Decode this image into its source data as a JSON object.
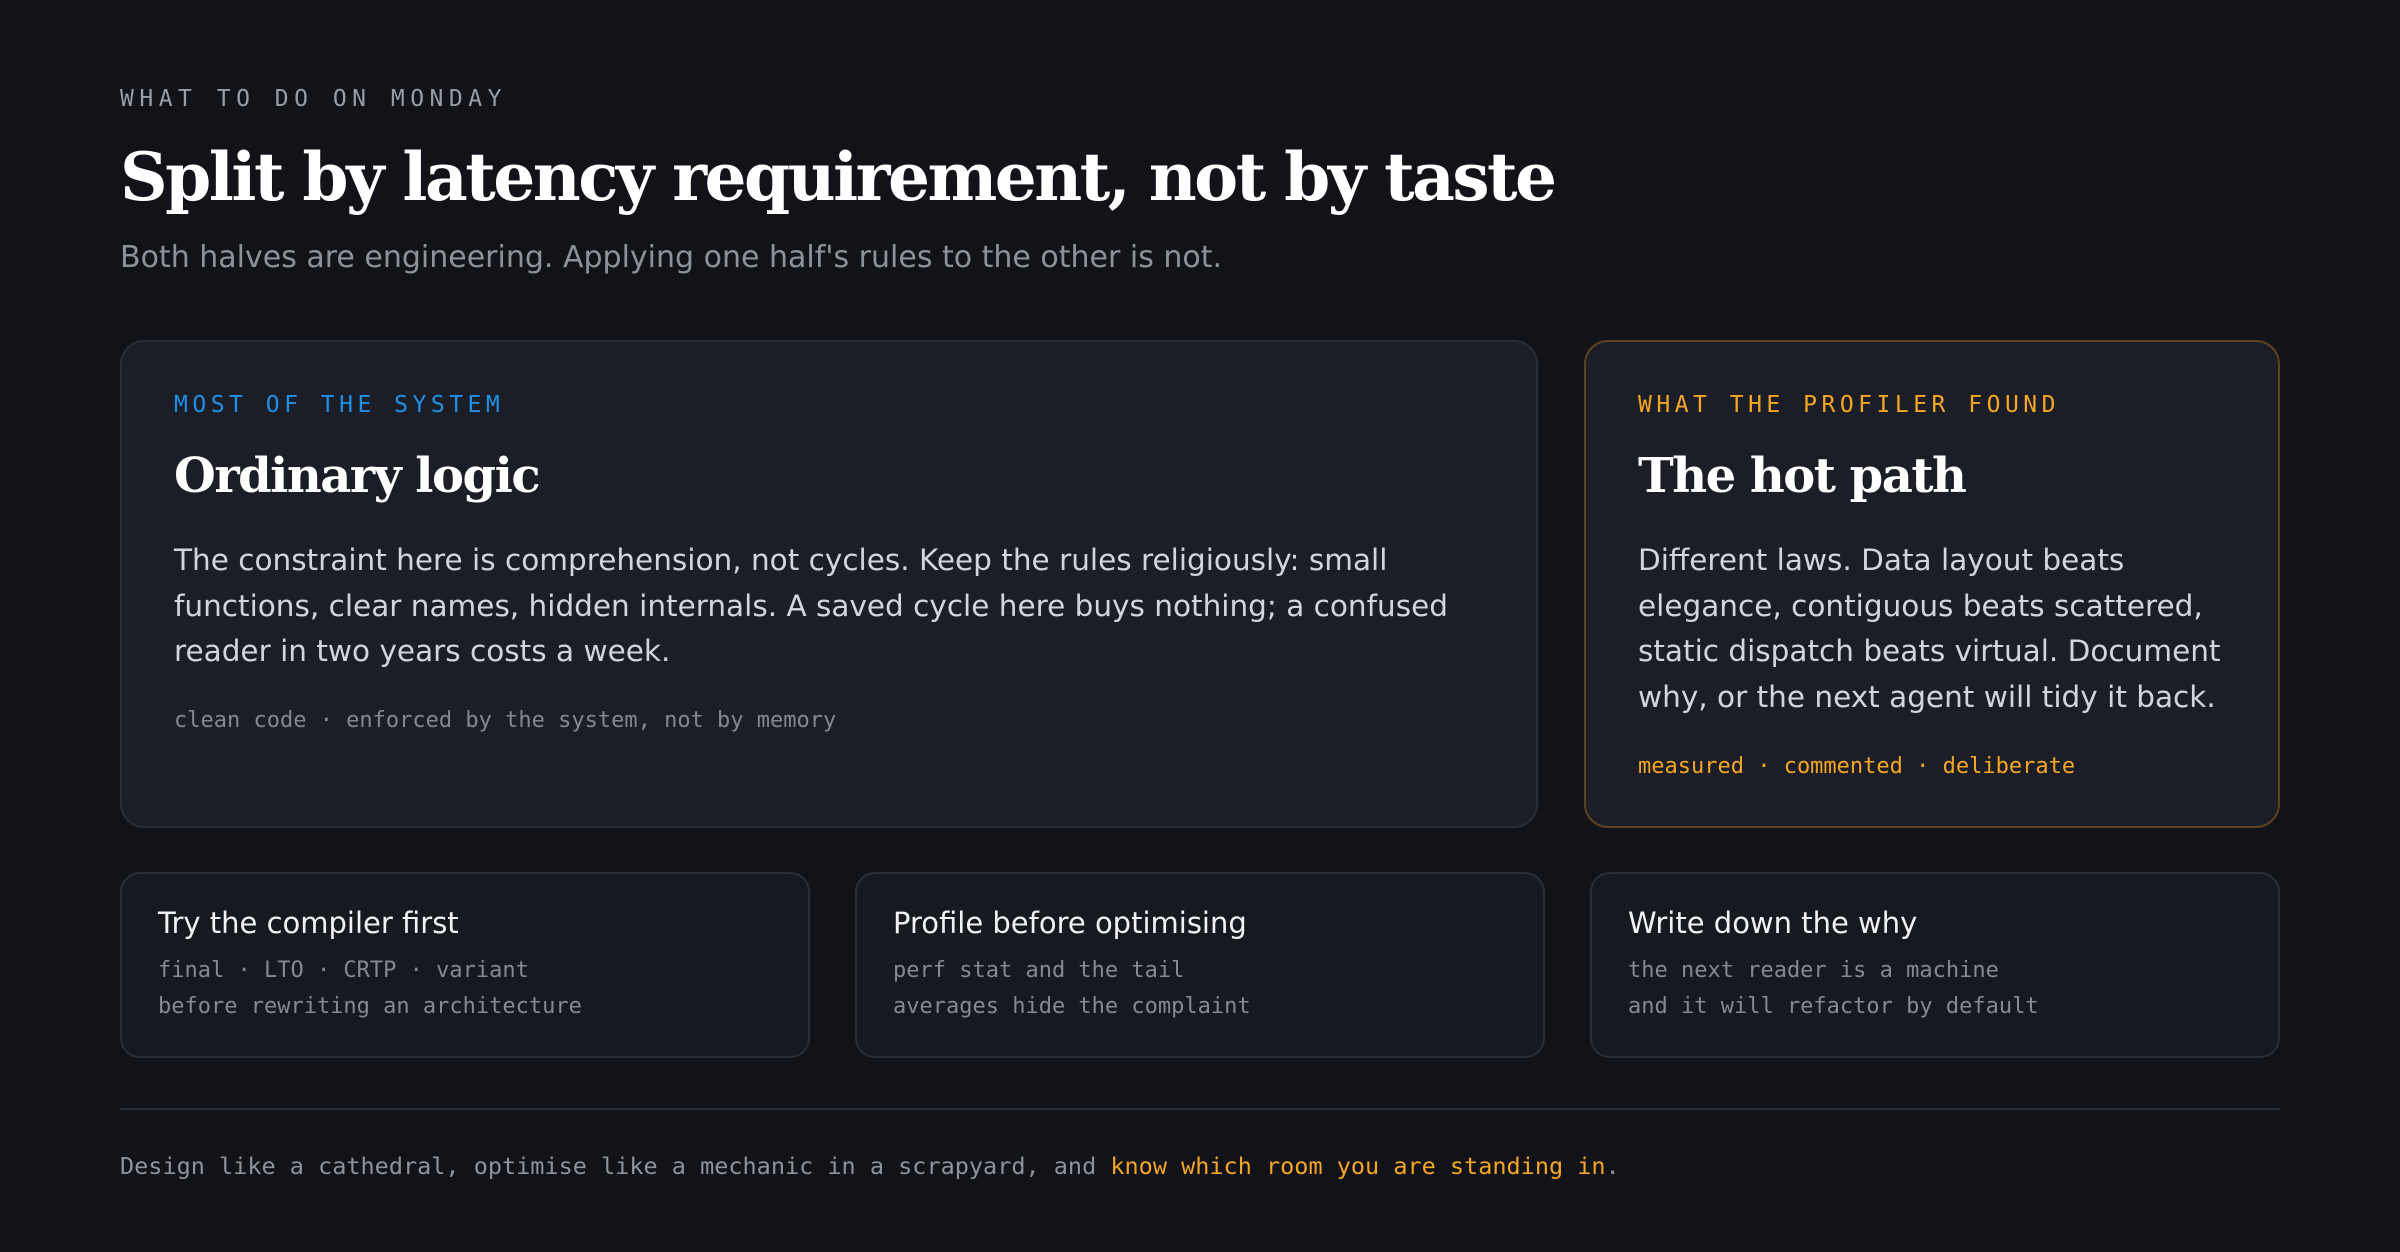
{
  "header": {
    "eyebrow": "WHAT TO DO ON MONDAY",
    "title": "Split by latency requirement, not by taste",
    "subtitle": "Both halves are engineering. Applying one half's rules to the other is not."
  },
  "cards": {
    "ordinary": {
      "label": "MOST OF THE SYSTEM",
      "label_color": "#1e90e6",
      "heading": "Ordinary logic",
      "body": "The constraint here is comprehension, not cycles. Keep the rules religiously: small functions, clear names, hidden internals. A saved cycle here buys nothing; a confused reader in two years costs a week.",
      "foot": "clean code · enforced by the system, not by memory"
    },
    "hot": {
      "label": "WHAT THE PROFILER FOUND",
      "label_color": "#f5a623",
      "heading": "The hot path",
      "body": "Different laws. Data layout beats elegance, contiguous beats scattered, static dispatch beats virtual. Document why, or the next agent will tidy it back.",
      "foot": "measured · commented · deliberate"
    }
  },
  "tips": [
    {
      "title": "Try the compiler first",
      "line1": "final · LTO · CRTP · variant",
      "line2": "before rewriting an architecture"
    },
    {
      "title": "Profile before optimising",
      "line1": "perf stat and the tail",
      "line2": "averages hide the complaint"
    },
    {
      "title": "Write down the why",
      "line1": "the next reader is a machine",
      "line2": "and it will refactor by default"
    }
  ],
  "footer": {
    "prefix": "Design like a cathedral, optimise like a mechanic in a scrapyard, and ",
    "highlight": "know which room you are standing in",
    "suffix": "."
  },
  "colors": {
    "background": "#121319",
    "accent_blue": "#1e90e6",
    "accent_orange": "#f5a623"
  }
}
